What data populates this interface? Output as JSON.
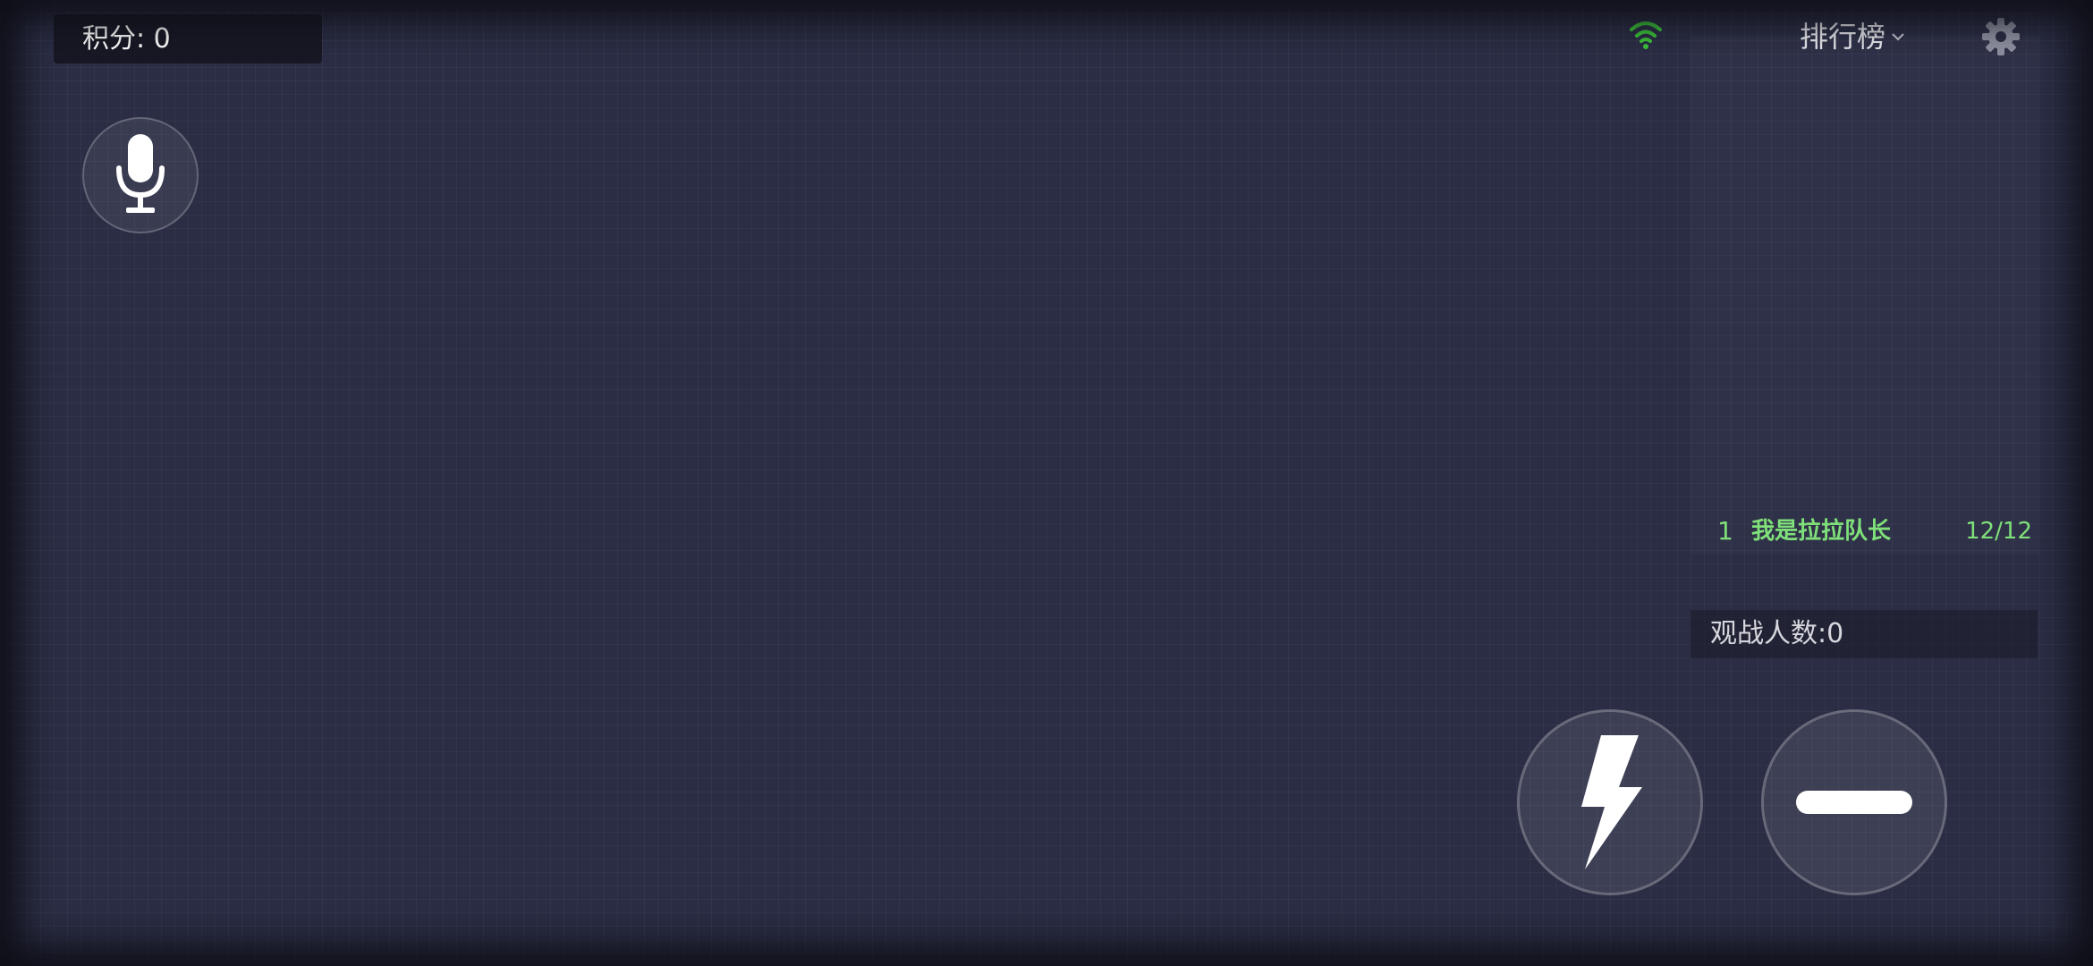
{
  "score": {
    "text": "积分: 0"
  },
  "toolbar": {
    "leaderboard_label": "排行榜",
    "wifi_color": "#3dc43a"
  },
  "leaderboard": {
    "entries": [
      {
        "rank": "1",
        "name": "我是拉拉队长",
        "count": "12/12"
      }
    ],
    "entry_color": "#7fe07a"
  },
  "spectators": {
    "text": "观战人数:0"
  },
  "icons": {
    "mic": "microphone-icon",
    "wifi": "wifi-icon",
    "chevron": "chevron-down-icon",
    "settings": "gear-icon",
    "boost": "lightning-bolt-icon",
    "shrink": "minus-icon"
  },
  "colors": {
    "background": "#2a2d44",
    "panel": "#14151e",
    "text": "#ffffff"
  }
}
